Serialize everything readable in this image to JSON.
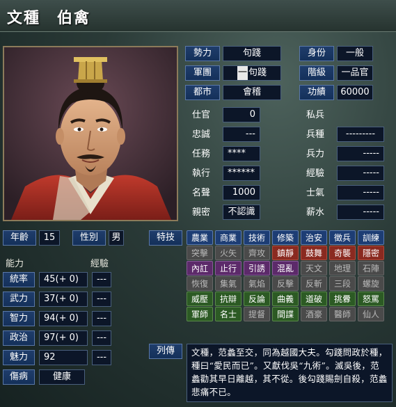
{
  "title": {
    "surname": "文種",
    "given": "伯禽"
  },
  "info": {
    "faction": {
      "label": "勢力",
      "value": "句踐"
    },
    "corps": {
      "label": "軍團",
      "value": "句踐",
      "marker": "一"
    },
    "city": {
      "label": "都市",
      "value": "會稽"
    },
    "service": {
      "label": "仕官",
      "value": "0"
    },
    "loyalty": {
      "label": "忠誠",
      "value": "---"
    },
    "duty": {
      "label": "任務",
      "value": "****"
    },
    "execute": {
      "label": "執行",
      "value": "******"
    },
    "fame": {
      "label": "名聲",
      "value": "1000"
    },
    "intimacy": {
      "label": "親密",
      "value": "不認識"
    },
    "status": {
      "label": "身份",
      "value": "一般"
    },
    "rank": {
      "label": "階級",
      "value": "一品官"
    },
    "merit": {
      "label": "功績",
      "value": "60000"
    },
    "private_troops": {
      "label": "私兵"
    },
    "troop_type": {
      "label": "兵種",
      "value": "---------"
    },
    "troops": {
      "label": "兵力",
      "value": "-----"
    },
    "experience": {
      "label": "經驗",
      "value": "-----"
    },
    "morale": {
      "label": "士氣",
      "value": "-----"
    },
    "salary": {
      "label": "薪水",
      "value": "-----"
    }
  },
  "basic": {
    "age_label": "年齡",
    "age": "15",
    "gender_label": "性別",
    "gender": "男"
  },
  "abilities": {
    "header": "能力",
    "exp_header": "經驗",
    "rows": [
      {
        "label": "統率",
        "value": "45(+ 0)",
        "exp": "---"
      },
      {
        "label": "武力",
        "value": "37(+ 0)",
        "exp": "---"
      },
      {
        "label": "智力",
        "value": "94(+ 0)",
        "exp": "---"
      },
      {
        "label": "政治",
        "value": "97(+ 0)",
        "exp": "---"
      },
      {
        "label": "魅力",
        "value": "92",
        "exp": "---"
      }
    ],
    "injury_label": "傷病",
    "injury": "健康"
  },
  "skills": {
    "label": "特技",
    "rows": [
      [
        {
          "t": "農業",
          "c": "blue"
        },
        {
          "t": "商業",
          "c": "blue"
        },
        {
          "t": "技術",
          "c": "blue"
        },
        {
          "t": "修築",
          "c": "blue"
        },
        {
          "t": "治安",
          "c": "blue"
        },
        {
          "t": "徵兵",
          "c": "blue"
        },
        {
          "t": "訓練",
          "c": "blue"
        }
      ],
      [
        {
          "t": "突擊",
          "c": "gray"
        },
        {
          "t": "火矢",
          "c": "gray"
        },
        {
          "t": "齊攻",
          "c": "gray"
        },
        {
          "t": "鎮靜",
          "c": "red"
        },
        {
          "t": "鼓舞",
          "c": "red"
        },
        {
          "t": "奇襲",
          "c": "red"
        },
        {
          "t": "隱密",
          "c": "red"
        }
      ],
      [
        {
          "t": "內訌",
          "c": "purple"
        },
        {
          "t": "止行",
          "c": "purple"
        },
        {
          "t": "引誘",
          "c": "purple"
        },
        {
          "t": "混亂",
          "c": "purple"
        },
        {
          "t": "天文",
          "c": "gray"
        },
        {
          "t": "地理",
          "c": "gray"
        },
        {
          "t": "石陣",
          "c": "gray"
        }
      ],
      [
        {
          "t": "恢復",
          "c": "gray"
        },
        {
          "t": "集氣",
          "c": "gray"
        },
        {
          "t": "氣焰",
          "c": "gray"
        },
        {
          "t": "反擊",
          "c": "gray"
        },
        {
          "t": "反斬",
          "c": "gray"
        },
        {
          "t": "三段",
          "c": "gray"
        },
        {
          "t": "螺旋",
          "c": "gray"
        }
      ],
      [
        {
          "t": "威壓",
          "c": "green"
        },
        {
          "t": "抗辯",
          "c": "green"
        },
        {
          "t": "反論",
          "c": "green"
        },
        {
          "t": "曲義",
          "c": "green"
        },
        {
          "t": "道破",
          "c": "green"
        },
        {
          "t": "挑釁",
          "c": "green"
        },
        {
          "t": "怒罵",
          "c": "green"
        }
      ],
      [
        {
          "t": "軍師",
          "c": "green"
        },
        {
          "t": "名士",
          "c": "green"
        },
        {
          "t": "提督",
          "c": "gray"
        },
        {
          "t": "間諜",
          "c": "green"
        },
        {
          "t": "酒豪",
          "c": "gray"
        },
        {
          "t": "醫師",
          "c": "gray"
        },
        {
          "t": "仙人",
          "c": "gray"
        }
      ]
    ]
  },
  "biography": {
    "label": "列傳",
    "text": "文種，范蠡至交，同為越國大夫。勾踐問政於種，種曰“愛民而已”。又獻伐吳“九術”。滅吳後，范蠡勸其早日離越，其不從。後勾踐賜劍自殺，范蠡悲痛不已。"
  },
  "colors": {
    "label_bg": "#1f3d6b",
    "value_bg": "#0c1628",
    "skill_blue": "#1d3d74",
    "skill_red": "#8a2a20",
    "skill_purple": "#5c2a6a",
    "skill_green": "#2c5a24",
    "skill_gray": "#4a4a4a"
  }
}
